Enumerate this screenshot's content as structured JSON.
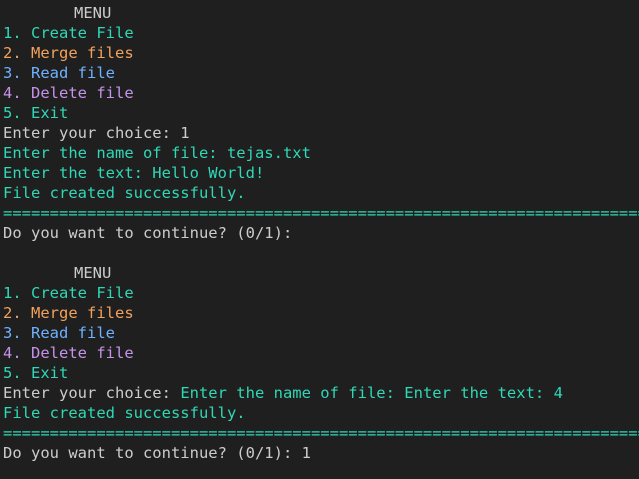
{
  "colors": {
    "background": "#1f1f1f",
    "default_text": "#cccccc",
    "teal": "#2fd8b6",
    "orange": "#f2a25c",
    "blue": "#6fb1ff",
    "violet": "#c792ea"
  },
  "session1": {
    "menu_title": "MENU",
    "menu_items": [
      "1. Create File",
      "2. Merge files",
      "3. Read file",
      "4. Delete file",
      "5. Exit"
    ],
    "choice_prompt": "Enter your choice: 1",
    "filename_prompt": "Enter the name of file: tejas.txt",
    "text_prompt": "Enter the text: Hello World!",
    "result": "File created successfully.",
    "separator": "========================================================================",
    "continue_prompt": "Do you want to continue? (0/1):"
  },
  "session2": {
    "menu_title": "MENU",
    "menu_items": [
      "1. Create File",
      "2. Merge files",
      "3. Read file",
      "4. Delete file",
      "5. Exit"
    ],
    "choice_prompt_label": "Enter your choice: ",
    "choice_prompt_rest": "Enter the name of file: Enter the text: 4",
    "result": "File created successfully.",
    "separator": "========================================================================",
    "continue_prompt": "Do you want to continue? (0/1): 1"
  }
}
